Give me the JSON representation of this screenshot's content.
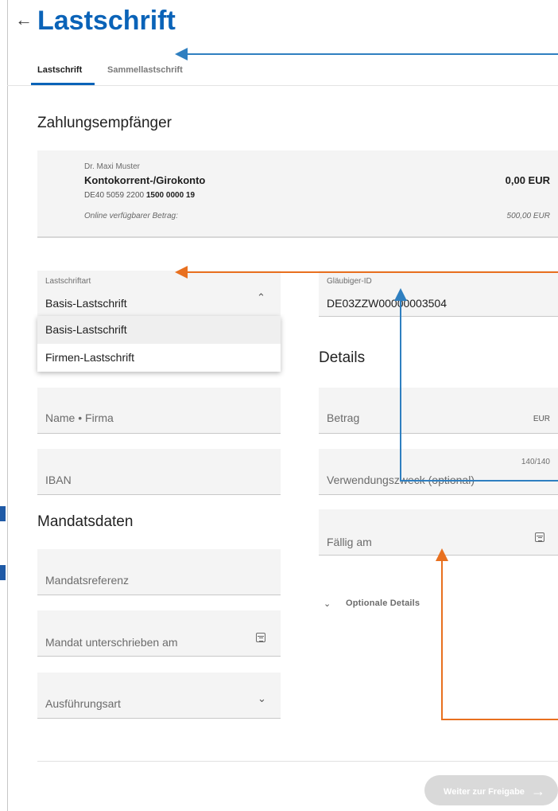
{
  "header": {
    "back_icon": "arrow-left-icon",
    "title": "Lastschrift"
  },
  "tabs": [
    {
      "label": "Lastschrift",
      "active": true
    },
    {
      "label": "Sammellastschrift",
      "active": false
    }
  ],
  "payee": {
    "heading": "Zahlungsempfänger",
    "name": "Dr. Maxi Muster",
    "account": "Kontokorrent-/Girokonto",
    "iban_prefix": "DE40 5059 2200",
    "iban_bold": "1500 0000 19",
    "balance": "0,00 EUR",
    "available_label": "Online verfügbarer Betrag:",
    "available_value": "500,00 EUR"
  },
  "form": {
    "debit_type": {
      "label": "Lastschriftart",
      "value": "Basis-Lastschrift",
      "options": [
        "Basis-Lastschrift",
        "Firmen-Lastschrift"
      ]
    },
    "creditor_id": {
      "label": "Gläubiger-ID",
      "value": "DE03ZZW00000003504"
    },
    "name_placeholder": "Name • Firma",
    "iban_placeholder": "IBAN",
    "mandate": {
      "heading": "Mandatsdaten",
      "reference_placeholder": "Mandatsreferenz",
      "signed_placeholder": "Mandat unterschrieben am",
      "execution_placeholder": "Ausführungsart"
    },
    "details": {
      "heading": "Details",
      "amount_placeholder": "Betrag",
      "currency": "EUR",
      "purpose_counter": "140/140",
      "purpose_placeholder": "Verwendungszweck (optional)",
      "due_placeholder": "Fällig am",
      "optional_details": "Optionale Details"
    }
  },
  "submit_label": "Weiter zur Freigabe",
  "colors": {
    "accent": "#0a63b8",
    "annotation_blue": "#2f7fc0",
    "annotation_orange": "#e8701f"
  }
}
